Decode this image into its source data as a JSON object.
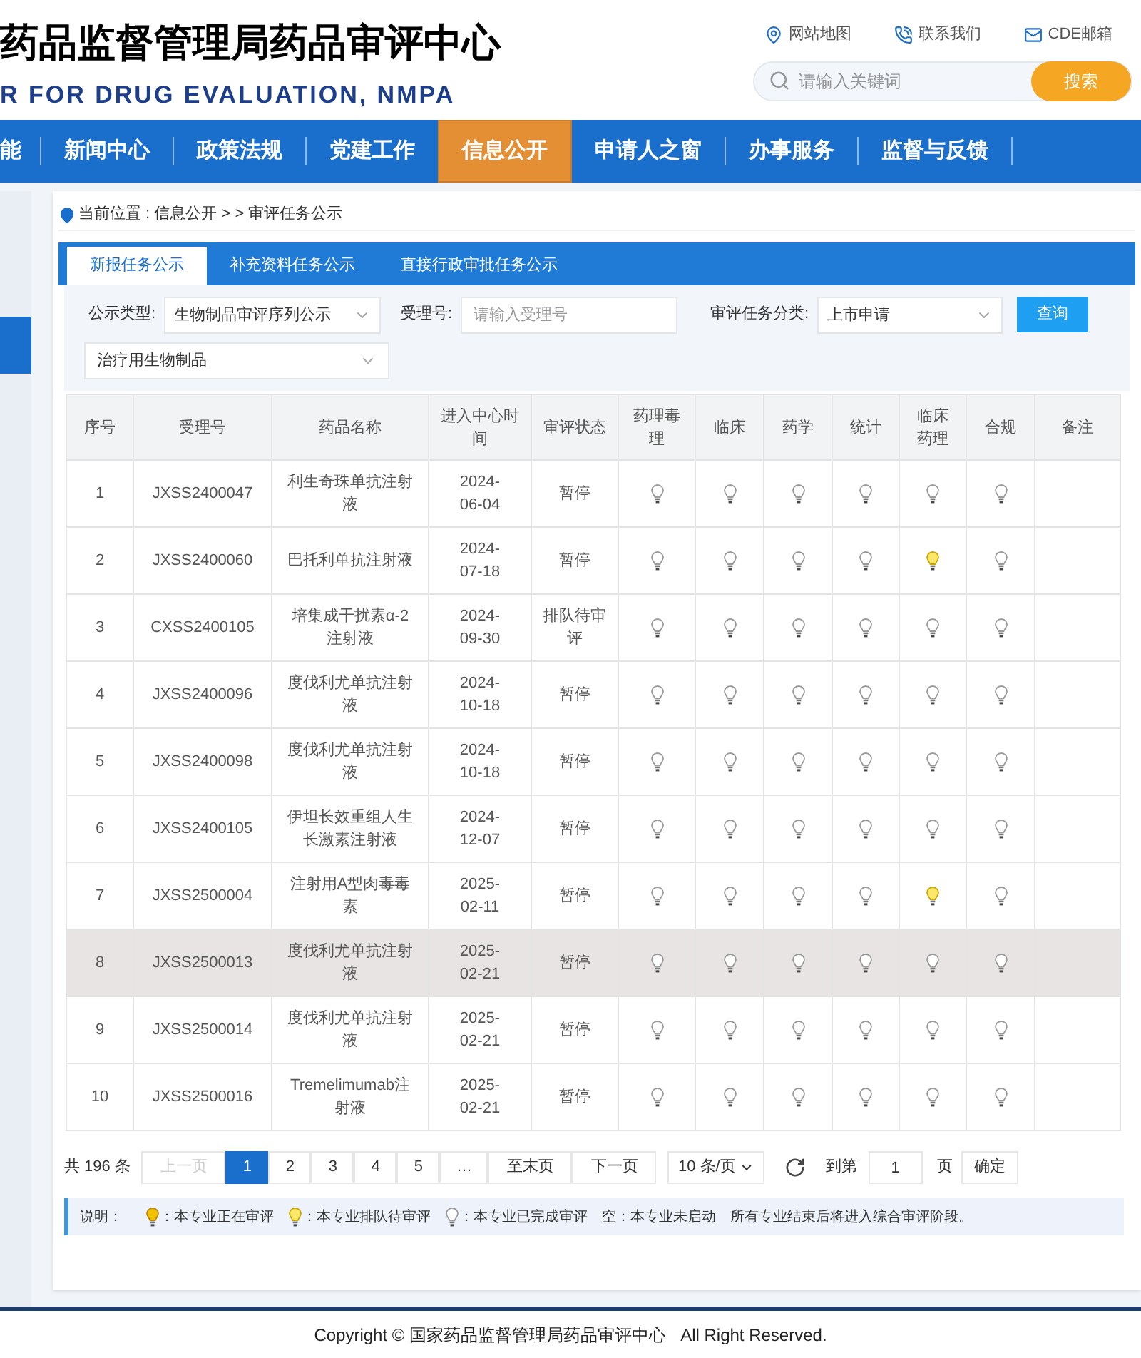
{
  "header": {
    "title": "药品监督管理局药品审评中心",
    "subtitle": "R FOR DRUG EVALUATION, NMPA",
    "links": [
      {
        "kind": "map",
        "label": "网站地图"
      },
      {
        "kind": "phone",
        "label": "联系我们"
      },
      {
        "kind": "mail",
        "label": "CDE邮箱"
      }
    ],
    "search": {
      "placeholder": "请输入关键词",
      "button": "搜索"
    }
  },
  "nav": [
    {
      "label": "能",
      "selected": false
    },
    {
      "label": "新闻中心",
      "selected": false
    },
    {
      "label": "政策法规",
      "selected": false
    },
    {
      "label": "党建工作",
      "selected": false
    },
    {
      "label": "信息公开",
      "selected": true
    },
    {
      "label": "申请人之窗",
      "selected": false
    },
    {
      "label": "办事服务",
      "selected": false
    },
    {
      "label": "监督与反馈",
      "selected": false
    }
  ],
  "breadcrumb": "当前位置 : 信息公开 > > 审评任务公示",
  "tabs": [
    {
      "label": "新报任务公示",
      "selected": true
    },
    {
      "label": "补充资料任务公示",
      "selected": false
    },
    {
      "label": "直接行政审批任务公示",
      "selected": false
    }
  ],
  "filters": [
    {
      "kind": "select",
      "label": "公示类型:",
      "value": "生物制品审评序列公示"
    },
    {
      "kind": "input",
      "label": "受理号:",
      "placeholder": "请输入受理号"
    },
    {
      "kind": "select",
      "label": "审评任务分类:",
      "value": "上市申请"
    }
  ],
  "query_button": "查询",
  "subtype_select": "治疗用生物制品",
  "table": {
    "columns": [
      "序号",
      "受理号",
      "药品名称",
      "进入中心时间",
      "审评状态",
      "药理毒理",
      "临床",
      "药学",
      "统计",
      "临床药理",
      "合规",
      "备注"
    ],
    "rows": [
      {
        "selected": false,
        "cells": [
          "1",
          "JXSS2400047",
          "利生奇珠单抗注射液",
          "2024-06-04",
          "暂停"
        ],
        "reviews": [
          {
            "kind": "done"
          },
          {
            "kind": "done"
          },
          {
            "kind": "done"
          },
          {
            "kind": "done"
          },
          {
            "kind": "done"
          },
          {
            "kind": "done"
          }
        ]
      },
      {
        "selected": false,
        "cells": [
          "2",
          "JXSS2400060",
          "巴托利单抗注射液",
          "2024-07-18",
          "暂停"
        ],
        "reviews": [
          {
            "kind": "done"
          },
          {
            "kind": "done"
          },
          {
            "kind": "done"
          },
          {
            "kind": "done"
          },
          {
            "kind": "queued"
          },
          {
            "kind": "done"
          }
        ]
      },
      {
        "selected": false,
        "cells": [
          "3",
          "CXSS2400105",
          "培集成干扰素α-2注射液",
          "2024-09-30",
          "排队待审评"
        ],
        "reviews": [
          {
            "kind": "done"
          },
          {
            "kind": "done"
          },
          {
            "kind": "done"
          },
          {
            "kind": "done"
          },
          {
            "kind": "done"
          },
          {
            "kind": "done"
          }
        ]
      },
      {
        "selected": false,
        "cells": [
          "4",
          "JXSS2400096",
          "度伐利尤单抗注射液",
          "2024-10-18",
          "暂停"
        ],
        "reviews": [
          {
            "kind": "done"
          },
          {
            "kind": "done"
          },
          {
            "kind": "done"
          },
          {
            "kind": "done"
          },
          {
            "kind": "done"
          },
          {
            "kind": "done"
          }
        ]
      },
      {
        "selected": false,
        "cells": [
          "5",
          "JXSS2400098",
          "度伐利尤单抗注射液",
          "2024-10-18",
          "暂停"
        ],
        "reviews": [
          {
            "kind": "done"
          },
          {
            "kind": "done"
          },
          {
            "kind": "done"
          },
          {
            "kind": "done"
          },
          {
            "kind": "done"
          },
          {
            "kind": "done"
          }
        ]
      },
      {
        "selected": false,
        "cells": [
          "6",
          "JXSS2400105",
          "伊坦长效重组人生长激素注射液",
          "2024-12-07",
          "暂停"
        ],
        "reviews": [
          {
            "kind": "done"
          },
          {
            "kind": "done"
          },
          {
            "kind": "done"
          },
          {
            "kind": "done"
          },
          {
            "kind": "done"
          },
          {
            "kind": "done"
          }
        ]
      },
      {
        "selected": false,
        "cells": [
          "7",
          "JXSS2500004",
          "注射用A型肉毒毒素",
          "2025-02-11",
          "暂停"
        ],
        "reviews": [
          {
            "kind": "done"
          },
          {
            "kind": "done"
          },
          {
            "kind": "done"
          },
          {
            "kind": "done"
          },
          {
            "kind": "queued"
          },
          {
            "kind": "done"
          }
        ]
      },
      {
        "selected": true,
        "cells": [
          "8",
          "JXSS2500013",
          "度伐利尤单抗注射液",
          "2025-02-21",
          "暂停"
        ],
        "reviews": [
          {
            "kind": "done"
          },
          {
            "kind": "done"
          },
          {
            "kind": "done"
          },
          {
            "kind": "done"
          },
          {
            "kind": "done"
          },
          {
            "kind": "done"
          }
        ]
      },
      {
        "selected": false,
        "cells": [
          "9",
          "JXSS2500014",
          "度伐利尤单抗注射液",
          "2025-02-21",
          "暂停"
        ],
        "reviews": [
          {
            "kind": "done"
          },
          {
            "kind": "done"
          },
          {
            "kind": "done"
          },
          {
            "kind": "done"
          },
          {
            "kind": "done"
          },
          {
            "kind": "done"
          }
        ]
      },
      {
        "selected": false,
        "cells": [
          "10",
          "JXSS2500016",
          "Tremelimumab注射液",
          "2025-02-21",
          "暂停"
        ],
        "reviews": [
          {
            "kind": "done"
          },
          {
            "kind": "done"
          },
          {
            "kind": "done"
          },
          {
            "kind": "done"
          },
          {
            "kind": "done"
          },
          {
            "kind": "done"
          }
        ]
      }
    ]
  },
  "pagination": {
    "total": "共 196 条",
    "prev": {
      "label": "上一页",
      "disabled": true
    },
    "pages": [
      {
        "label": "1",
        "selected": true
      },
      {
        "label": "2",
        "selected": false
      },
      {
        "label": "3",
        "selected": false
      },
      {
        "label": "4",
        "selected": false
      },
      {
        "label": "5",
        "selected": false
      }
    ],
    "ellipsis": "…",
    "last": "至末页",
    "next": "下一页",
    "page_size": "10 条/页",
    "goto": "到第",
    "page_value": "1",
    "page_unit": "页",
    "confirm": "确定"
  },
  "legend": {
    "label": "说明：",
    "items": [
      {
        "kind": "active",
        "text": "：本专业正在审评"
      },
      {
        "kind": "queued",
        "text": "：本专业排队待审评"
      },
      {
        "kind": "done",
        "text": "：本专业已完成审评"
      }
    ],
    "notes": [
      "空：本专业未启动",
      "所有专业结束后将进入综合审评阶段。"
    ]
  },
  "footer": "Copyright © 国家药品监督管理局药品审评中心   All Right Reserved."
}
